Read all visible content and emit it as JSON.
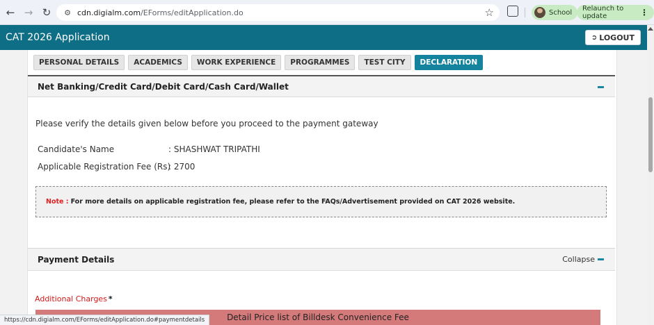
{
  "browser": {
    "back_icon": "arrow-left-icon",
    "forward_icon": "arrow-right-icon",
    "reload_icon": "reload-icon",
    "site_info_icon": "tune-icon",
    "url_host": "cdn.digialm.com",
    "url_path": "/EForms/editApplication.do",
    "bookmark_icon": "star-icon",
    "extensions_icon": "extensions-icon",
    "profile_label": "School",
    "relaunch_label": "Relaunch to update"
  },
  "header": {
    "title": "CAT 2026 Application",
    "logout_label": "LOGOUT",
    "logout_icon": "logout-icon",
    "accent": "#0e6e86"
  },
  "tabs": [
    {
      "label": "PERSONAL DETAILS",
      "active": false
    },
    {
      "label": "ACADEMICS",
      "active": false
    },
    {
      "label": "WORK EXPERIENCE",
      "active": false
    },
    {
      "label": "PROGRAMMES",
      "active": false
    },
    {
      "label": "TEST CITY",
      "active": false
    },
    {
      "label": "DECLARATION",
      "active": true
    }
  ],
  "payment_section": {
    "title": "Net Banking/Credit Card/Debit Card/Cash Card/Wallet",
    "verify_text": "Please verify the details given below before you proceed to the payment gateway",
    "candidate_label": "Candidate's Name",
    "candidate_value": ": SHASHWAT TRIPATHI",
    "fee_label": "Applicable Registration Fee (Rs)",
    "fee_value": ": 2700",
    "note_label": "Note :",
    "note_text": "For more details on applicable registration fee, please refer to the FAQs/Advertisement provided on CAT 2026 website."
  },
  "payment_details": {
    "title": "Payment Details",
    "collapse_label": "Collapse",
    "additional_charges_label": "Additional Charges",
    "required_mark": "*",
    "price_list_title": "Detail Price list of Billdesk Convenience Fee"
  },
  "status_bar": {
    "url": "https://cdn.digialm.com/EForms/editApplication.do#paymentdetails"
  }
}
